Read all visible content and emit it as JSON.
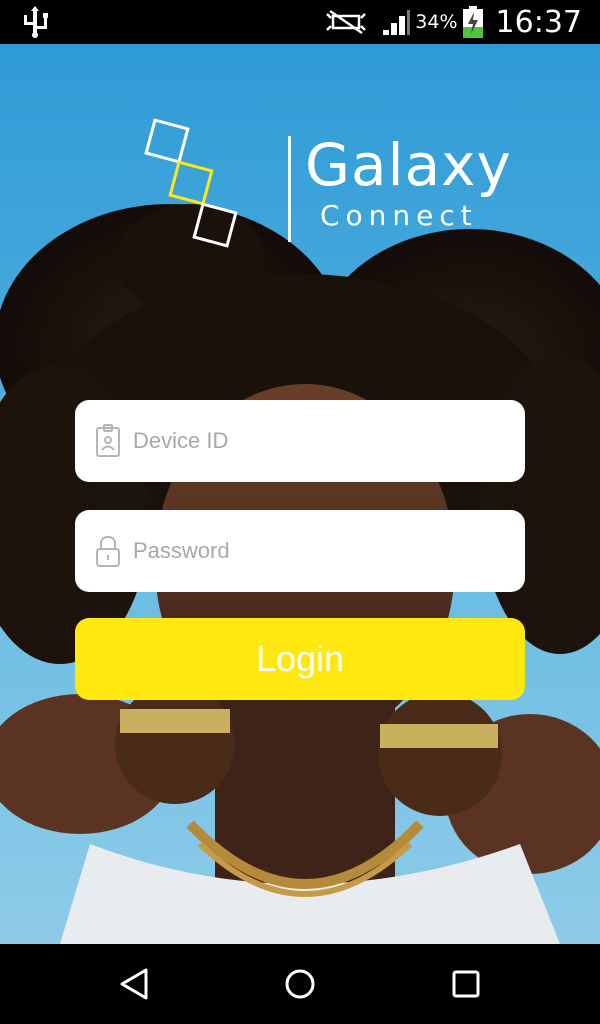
{
  "status_bar": {
    "battery_percent": "34%",
    "time": "16:37",
    "icons": [
      "usb-icon",
      "mute-icon",
      "signal-icon",
      "battery-charging-icon"
    ]
  },
  "logo": {
    "title": "Galaxy",
    "subtitle": "Connect",
    "accent_color": "#ffe80f"
  },
  "form": {
    "device_id": {
      "placeholder": "Device ID",
      "value": "",
      "icon": "id-badge-icon"
    },
    "password": {
      "placeholder": "Password",
      "value": "",
      "icon": "lock-icon"
    },
    "login_label": "Login"
  },
  "nav_bar": {
    "buttons": [
      "back-icon",
      "home-icon",
      "recents-icon"
    ]
  },
  "colors": {
    "sky": "#2f9bd6",
    "button": "#ffe80f",
    "field_bg": "#ffffff",
    "placeholder": "#a8a8a8"
  }
}
